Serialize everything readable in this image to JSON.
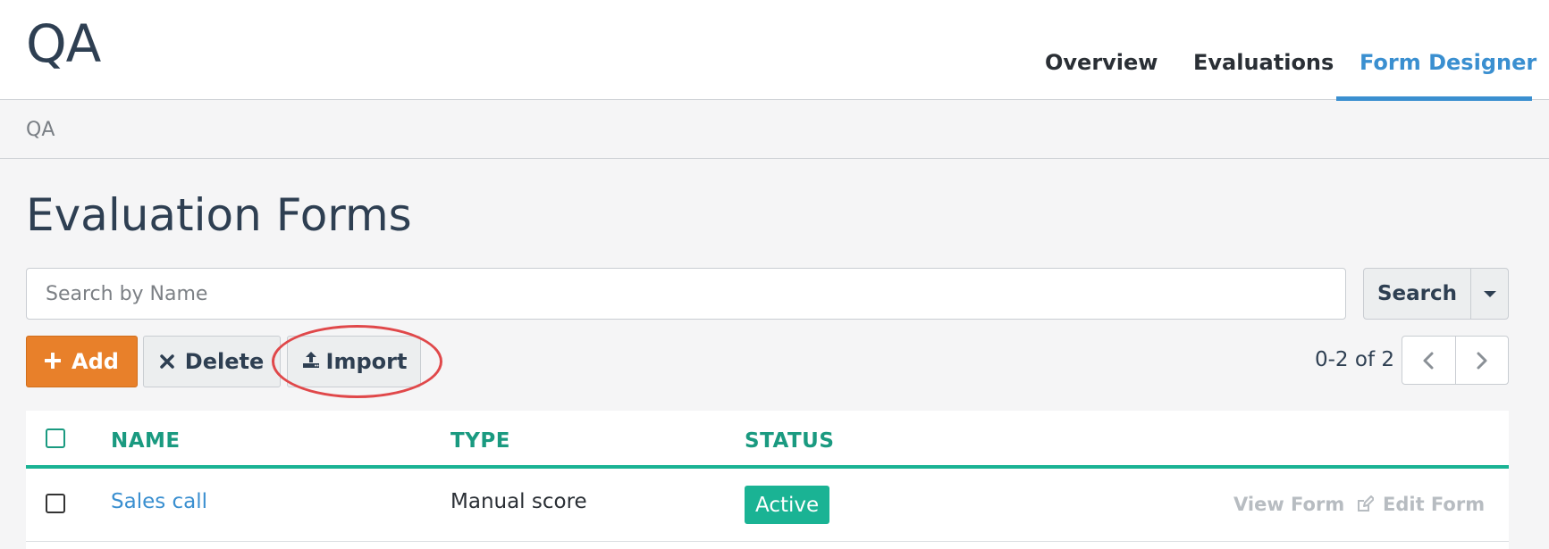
{
  "app": {
    "title": "QA"
  },
  "nav": {
    "tabs": [
      {
        "label": "Overview",
        "active": false
      },
      {
        "label": "Evaluations",
        "active": false
      },
      {
        "label": "Form Designer",
        "active": true
      }
    ]
  },
  "breadcrumb": {
    "items": [
      "QA"
    ]
  },
  "page": {
    "title": "Evaluation Forms"
  },
  "search": {
    "placeholder": "Search by Name",
    "value": "",
    "button_label": "Search"
  },
  "toolbar": {
    "add_label": "Add",
    "delete_label": "Delete",
    "import_label": "Import"
  },
  "pagination": {
    "range_text": "0-2 of 2"
  },
  "table": {
    "columns": [
      "NAME",
      "TYPE",
      "STATUS"
    ],
    "rows": [
      {
        "name": "Sales call",
        "type": "Manual score",
        "status": "Active",
        "actions": {
          "view": "View Form",
          "edit": "Edit Form"
        }
      }
    ]
  },
  "colors": {
    "accent": "#3a8fd0",
    "add_button": "#e8802a",
    "table_header": "#1a9a80",
    "status_active": "#1ab394",
    "highlight": "#e0484a"
  },
  "icons": {
    "add": "plus-icon",
    "delete": "times-icon",
    "import": "upload-icon",
    "prev": "chevron-left-icon",
    "next": "chevron-right-icon",
    "edit": "pencil-square-icon"
  }
}
